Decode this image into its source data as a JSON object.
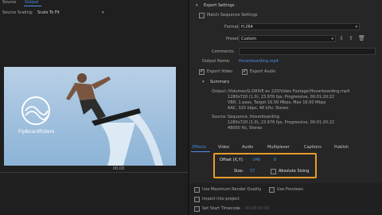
{
  "left": {
    "tabs": [
      "Source",
      "Output"
    ],
    "scaling_label": "Source Scaling:",
    "scaling_value": "Scale To Fit",
    "logo_text": "FlyBoardRiders",
    "time_marker": "00:00"
  },
  "export": {
    "section_title": "Export Settings",
    "match_sequence": "Match Sequence Settings",
    "format_label": "Format:",
    "format_value": "H.264",
    "preset_label": "Preset:",
    "preset_value": "Custom",
    "comments_label": "Comments:",
    "output_name_label": "Output Name:",
    "output_name_value": "Hoverboarding.mp4",
    "export_video": "Export Video",
    "export_audio": "Export Audio",
    "summary_title": "Summary",
    "output_label": "Output:",
    "output_lines": [
      "/Volumes/G-DRIVE ev 220/Video Footage/Hoverboarding.mp4",
      "1280x720 (1.0), 23.976 fps, Progressive, 00:01:20:22",
      "VBR, 1 pass, Target 16.00 Mbps, Max 16.00 Mbps",
      "AAC, 320 kbps, 48 kHz, Stereo"
    ],
    "source_label": "Source:",
    "source_lines": [
      "Sequence, Hoverboarding",
      "1280x720 (1.0), 23.976 fps, Progressive, 00:01:20:22",
      "48000 Hz, Stereo"
    ]
  },
  "tabs": [
    "Effects",
    "Video",
    "Audio",
    "Multiplexer",
    "Captions",
    "Publish"
  ],
  "effects": {
    "offset_label": "Offset (X,Y):",
    "offset_x": "-340",
    "offset_y": "0",
    "size_label": "Size:",
    "size_value": "57",
    "absolute_sizing": "Absolute Sizing"
  },
  "bottom": {
    "use_max_render": "Use Maximum Render Quality",
    "use_previews": "Use Previews",
    "import_project": "Import into project",
    "set_start_tc": "Set Start Timecode",
    "start_tc_value": "00:00:00:00"
  },
  "colors": {
    "accent": "#4a8fe6",
    "highlight": "#e89a2a"
  }
}
